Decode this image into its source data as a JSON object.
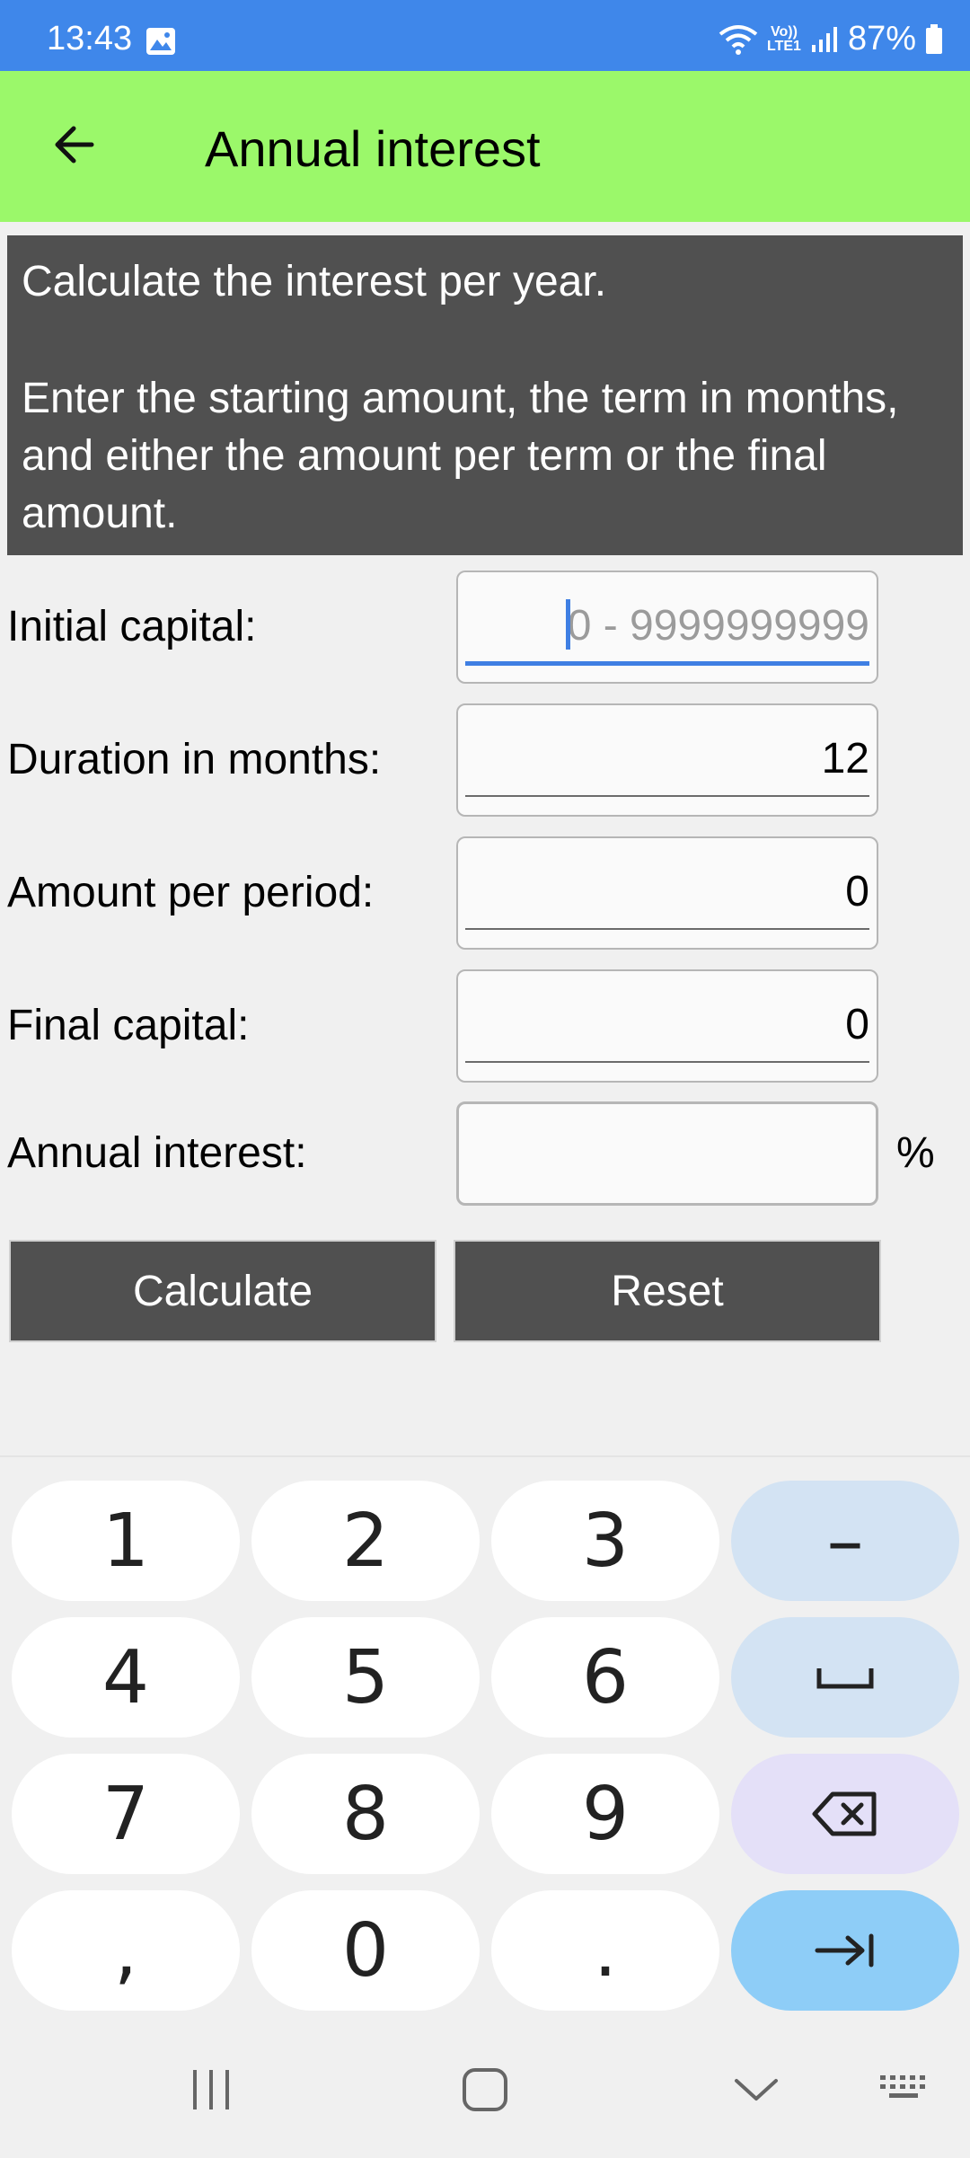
{
  "status_bar": {
    "time": "13:43",
    "network_top": "Vo))",
    "network_bottom": "LTE1",
    "battery": "87%"
  },
  "app_bar": {
    "title": "Annual interest"
  },
  "description": {
    "line1": "Calculate the interest per year.",
    "line2": "Enter the starting amount, the term in months, and either the amount per term or the final amount."
  },
  "form": {
    "initial_capital": {
      "label": "Initial capital:",
      "placeholder": "0 - 9999999999"
    },
    "duration": {
      "label": "Duration in months:",
      "value": "12"
    },
    "amount_per_period": {
      "label": "Amount per period:",
      "value": "0"
    },
    "final_capital": {
      "label": "Final capital:",
      "value": "0"
    },
    "annual_interest": {
      "label": "Annual interest:",
      "value": "",
      "unit": "%"
    }
  },
  "buttons": {
    "calculate": "Calculate",
    "reset": "Reset"
  },
  "keyboard": {
    "k1": "1",
    "k2": "2",
    "k3": "3",
    "minus": "–",
    "k4": "4",
    "k5": "5",
    "k6": "6",
    "k7": "7",
    "k8": "8",
    "k9": "9",
    "comma": ",",
    "k0": "0",
    "dot": "."
  },
  "colors": {
    "status_bar": "#3f87ea",
    "app_bar": "#9bf86a",
    "banner": "#505050",
    "button": "#505050",
    "focus": "#3f7fe3"
  }
}
